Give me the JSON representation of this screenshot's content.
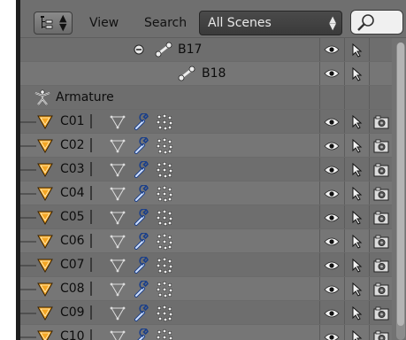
{
  "header": {
    "view_label": "View",
    "search_label": "Search",
    "scene_select_value": "All Scenes",
    "search_value": ""
  },
  "rows": [
    {
      "name": "B17",
      "kind": "bone",
      "expanded": true
    },
    {
      "name": "B18",
      "kind": "bone"
    },
    {
      "name": "Armature",
      "kind": "armature"
    },
    {
      "name": "C01",
      "kind": "mesh"
    },
    {
      "name": "C02",
      "kind": "mesh"
    },
    {
      "name": "C03",
      "kind": "mesh"
    },
    {
      "name": "C04",
      "kind": "mesh"
    },
    {
      "name": "C05",
      "kind": "mesh"
    },
    {
      "name": "C06",
      "kind": "mesh"
    },
    {
      "name": "C07",
      "kind": "mesh"
    },
    {
      "name": "C08",
      "kind": "mesh"
    },
    {
      "name": "C09",
      "kind": "mesh"
    },
    {
      "name": "C10",
      "kind": "mesh"
    }
  ],
  "icons": {
    "editor_type": "outliner-icon",
    "search": "magnifier-icon",
    "visibility": "eye-icon",
    "selectability": "cursor-icon",
    "render": "camera-icon",
    "bone": "bone-icon",
    "armature": "armature-icon",
    "mesh": "mesh-triangle-icon",
    "vertex_groups": "vertex-groups-icon",
    "modifier": "wrench-icon",
    "particles": "particles-icon"
  },
  "colors": {
    "mesh_orange": "#f5a623",
    "scene_dropdown_bg": "#424242",
    "outliner_bg": "#727272"
  }
}
